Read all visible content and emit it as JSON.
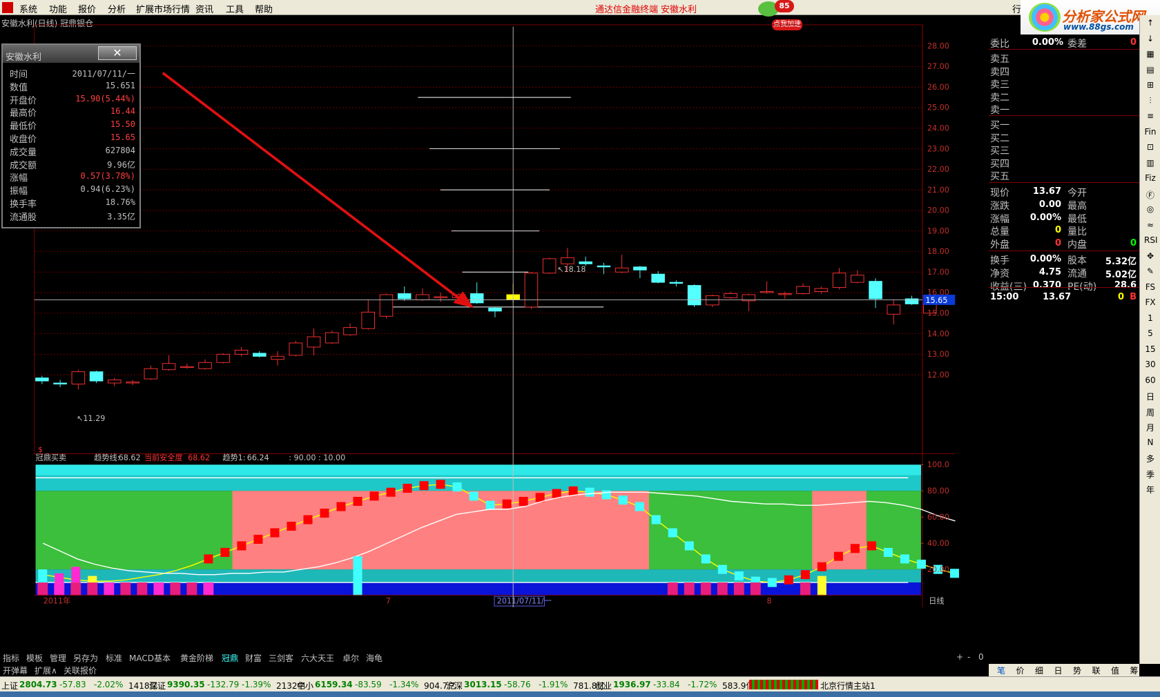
{
  "menu": {
    "items": [
      "系统",
      "功能",
      "报价",
      "分析",
      "扩展市场行情",
      "资讯",
      "工具",
      "帮助"
    ],
    "center_title_1": "通达信金融终端",
    "center_title_2": "安徽水利",
    "badge_num": "85",
    "badge_label": "点我加速",
    "logo_text": "分析家公式网",
    "logo_url": "www.88gs.com",
    "right_fragment": "行"
  },
  "chart": {
    "title": "安徽水利(日线) 冠鼎银仓",
    "price_axis": [
      "28.00",
      "27.00",
      "26.00",
      "25.00",
      "24.00",
      "23.00",
      "22.00",
      "21.00",
      "20.00",
      "19.00",
      "18.00",
      "17.00",
      "16.00",
      "15.00",
      "14.00",
      "13.00",
      "12.00"
    ],
    "crosshair_price": "15.65",
    "annot_high": "18.18",
    "annot_low": "11.29",
    "indicator_title": "冠鼎买卖",
    "ind_label_1": "趋势线:",
    "ind_val_1": "68.62",
    "ind_label_2": "当前安全度",
    "ind_val_2": "68.62",
    "ind_label_3": "趋势1:",
    "ind_val_3": "66.24",
    "ind_label_4": ": 90.00 : 10.00",
    "ind_axis": [
      "100.0",
      "80.00",
      "60.00",
      "40.00",
      "20.00"
    ],
    "date_left": "2011年",
    "date_m7": "7",
    "date_cursor": "2011/07/11/一",
    "date_m8": "8",
    "period": "日线"
  },
  "chart_data": {
    "type": "candlestick",
    "title": "安徽水利(日线) 冠鼎银仓",
    "ylim": [
      11.0,
      29.0
    ],
    "candles": [
      {
        "o": 11.85,
        "c": 11.7,
        "h": 11.95,
        "l": 11.55
      },
      {
        "o": 11.6,
        "c": 11.55,
        "h": 11.75,
        "l": 11.4
      },
      {
        "o": 11.55,
        "c": 12.15,
        "h": 12.25,
        "l": 11.29
      },
      {
        "o": 12.15,
        "c": 11.7,
        "h": 12.2,
        "l": 11.6
      },
      {
        "o": 11.6,
        "c": 11.75,
        "h": 11.85,
        "l": 11.45
      },
      {
        "o": 11.6,
        "c": 11.65,
        "h": 11.75,
        "l": 11.5
      },
      {
        "o": 11.8,
        "c": 12.3,
        "h": 12.45,
        "l": 11.75
      },
      {
        "o": 12.25,
        "c": 12.55,
        "h": 12.95,
        "l": 12.2
      },
      {
        "o": 12.4,
        "c": 12.4,
        "h": 12.55,
        "l": 12.3
      },
      {
        "o": 12.3,
        "c": 12.6,
        "h": 12.75,
        "l": 12.25
      },
      {
        "o": 12.6,
        "c": 13.0,
        "h": 13.05,
        "l": 12.55
      },
      {
        "o": 13.0,
        "c": 13.2,
        "h": 13.35,
        "l": 12.9
      },
      {
        "o": 13.05,
        "c": 12.9,
        "h": 13.15,
        "l": 12.85
      },
      {
        "o": 12.75,
        "c": 12.9,
        "h": 13.15,
        "l": 12.45
      },
      {
        "o": 12.95,
        "c": 13.55,
        "h": 13.65,
        "l": 12.9
      },
      {
        "o": 13.35,
        "c": 13.85,
        "h": 14.25,
        "l": 12.95
      },
      {
        "o": 13.55,
        "c": 14.05,
        "h": 14.15,
        "l": 13.5
      },
      {
        "o": 13.95,
        "c": 14.3,
        "h": 14.5,
        "l": 13.9
      },
      {
        "o": 14.25,
        "c": 15.05,
        "h": 15.65,
        "l": 14.2
      },
      {
        "o": 14.85,
        "c": 15.9,
        "h": 15.95,
        "l": 14.75
      },
      {
        "o": 15.95,
        "c": 15.7,
        "h": 16.3,
        "l": 15.6
      },
      {
        "o": 15.65,
        "c": 15.9,
        "h": 16.2,
        "l": 15.6
      },
      {
        "o": 15.8,
        "c": 15.8,
        "h": 16.0,
        "l": 15.55
      },
      {
        "o": 15.75,
        "c": 15.9,
        "h": 15.95,
        "l": 15.6
      },
      {
        "o": 15.95,
        "c": 15.5,
        "h": 16.5,
        "l": 15.45
      },
      {
        "o": 15.25,
        "c": 15.1,
        "h": 15.3,
        "l": 14.8
      },
      {
        "o": 15.9,
        "c": 15.65,
        "h": 16.44,
        "l": 15.5
      },
      {
        "o": 15.3,
        "c": 16.95,
        "h": 17.0,
        "l": 15.2
      },
      {
        "o": 16.95,
        "c": 17.65,
        "h": 17.7,
        "l": 16.9
      },
      {
        "o": 17.4,
        "c": 17.7,
        "h": 18.18,
        "l": 17.05
      },
      {
        "o": 17.5,
        "c": 17.4,
        "h": 17.75,
        "l": 17.3
      },
      {
        "o": 17.3,
        "c": 17.25,
        "h": 17.45,
        "l": 16.9
      },
      {
        "o": 17.0,
        "c": 17.2,
        "h": 17.85,
        "l": 16.95
      },
      {
        "o": 17.25,
        "c": 17.1,
        "h": 17.3,
        "l": 16.7
      },
      {
        "o": 16.9,
        "c": 16.5,
        "h": 17.05,
        "l": 16.45
      },
      {
        "o": 16.5,
        "c": 16.45,
        "h": 16.6,
        "l": 16.3
      },
      {
        "o": 16.35,
        "c": 15.4,
        "h": 16.4,
        "l": 15.3
      },
      {
        "o": 15.4,
        "c": 15.85,
        "h": 15.9,
        "l": 15.3
      },
      {
        "o": 15.75,
        "c": 15.95,
        "h": 16.05,
        "l": 15.7
      },
      {
        "o": 15.6,
        "c": 15.9,
        "h": 15.95,
        "l": 15.1
      },
      {
        "o": 16.0,
        "c": 16.05,
        "h": 16.55,
        "l": 15.95
      },
      {
        "o": 15.95,
        "c": 15.95,
        "h": 16.05,
        "l": 15.7
      },
      {
        "o": 15.95,
        "c": 16.3,
        "h": 16.45,
        "l": 15.9
      },
      {
        "o": 16.05,
        "c": 16.2,
        "h": 16.3,
        "l": 15.95
      },
      {
        "o": 16.25,
        "c": 16.95,
        "h": 17.2,
        "l": 16.15
      },
      {
        "o": 16.5,
        "c": 16.85,
        "h": 17.1,
        "l": 16.45
      },
      {
        "o": 16.55,
        "c": 15.7,
        "h": 16.7,
        "l": 15.25
      },
      {
        "o": 14.95,
        "c": 15.4,
        "h": 15.65,
        "l": 14.45
      },
      {
        "o": 15.7,
        "c": 15.45,
        "h": 15.85,
        "l": 15.4
      },
      {
        "o": 15.0,
        "c": 15.75,
        "h": 15.8,
        "l": 14.95
      }
    ],
    "resistance_lines": [
      25.5,
      23.0,
      21.0,
      19.0,
      17.0,
      15.3
    ],
    "indicator": {
      "ylim": [
        0,
        100
      ],
      "trend_line": [
        16,
        14,
        12,
        11,
        11,
        12,
        14,
        16,
        19,
        23,
        28,
        33,
        38,
        43,
        48,
        53,
        58,
        63,
        68,
        72,
        76,
        79,
        82,
        84,
        85,
        83,
        76,
        69,
        70,
        72,
        75,
        78,
        80,
        79,
        77,
        73,
        68,
        58,
        48,
        38,
        28,
        20,
        15,
        11,
        10,
        12,
        16,
        22,
        30,
        36,
        38,
        33,
        28,
        24,
        20,
        17
      ],
      "white_line": [
        40,
        34,
        28,
        24,
        21,
        19,
        18,
        17,
        17,
        16,
        16,
        17,
        17,
        18,
        18,
        20,
        22,
        25,
        29,
        34,
        40,
        46,
        52,
        57,
        62,
        64,
        66,
        66,
        68,
        72,
        75,
        77,
        78,
        79,
        79,
        79,
        78,
        77,
        76,
        74,
        72,
        71,
        70,
        70,
        69,
        69,
        70,
        71,
        72,
        71,
        69,
        66,
        61,
        57
      ],
      "pink_zones": [
        [
          11,
          33
        ],
        [
          43,
          45
        ]
      ]
    }
  },
  "infobox": {
    "title": "安徽水利",
    "close": "✕",
    "rows": [
      {
        "label": "时间",
        "value": "2011/07/11/一",
        "red": false
      },
      {
        "label": "数值",
        "value": "15.651",
        "red": false
      },
      {
        "label": "开盘价",
        "value": "15.90(5.44%)",
        "red": true
      },
      {
        "label": "最高价",
        "value": "16.44",
        "red": true
      },
      {
        "label": "最低价",
        "value": "15.50",
        "red": true
      },
      {
        "label": "收盘价",
        "value": "15.65",
        "red": true
      },
      {
        "label": "成交量",
        "value": "627804",
        "red": false
      },
      {
        "label": "成交额",
        "value": "9.96亿",
        "red": false
      },
      {
        "label": "涨幅",
        "value": "0.57(3.78%)",
        "red": true
      },
      {
        "label": "振幅",
        "value": "0.94(6.23%)",
        "red": false
      },
      {
        "label": "换手率",
        "value": "18.76%",
        "red": false
      },
      {
        "label": "流通股",
        "value": "3.35亿",
        "red": false
      }
    ]
  },
  "quote": {
    "weibi_label": "委比",
    "weibi_val": "0.00%",
    "weicha_label": "委差",
    "weicha_val": "0",
    "sells": [
      "卖五",
      "卖四",
      "卖三",
      "卖二",
      "卖一"
    ],
    "buys": [
      "买一",
      "买二",
      "买三",
      "买四",
      "买五"
    ],
    "r1": {
      "l1": "现价",
      "v1": "13.67",
      "l2": "今开",
      "v2": ""
    },
    "r2": {
      "l1": "涨跌",
      "v1": "0.00",
      "l2": "最高",
      "v2": ""
    },
    "r3": {
      "l1": "涨幅",
      "v1": "0.00%",
      "l2": "最低",
      "v2": ""
    },
    "r4": {
      "l1": "总量",
      "v1": "0",
      "l2": "量比",
      "v2": ""
    },
    "r5": {
      "l1": "外盘",
      "v1": "0",
      "l2": "内盘",
      "v2": "0"
    },
    "r6": {
      "l1": "换手",
      "v1": "0.00%",
      "l2": "股本",
      "v2": "5.32亿"
    },
    "r7": {
      "l1": "净资",
      "v1": "4.75",
      "l2": "流通",
      "v2": "5.02亿"
    },
    "r8": {
      "l1": "收益(三)",
      "v1": "0.370",
      "l2": "PE(动)",
      "v2": "28.6"
    },
    "tick": {
      "time": "15:00",
      "price": "13.67",
      "vol": "0",
      "side": "B"
    }
  },
  "side_toolbar": [
    "↑",
    "↓",
    "▦",
    "▤",
    "⊞",
    "⫶",
    "≡",
    "Fin",
    "⊡",
    "▥",
    "Fiz",
    "Ⓕ",
    "◎",
    "≈",
    "RSI",
    "✥",
    "✎",
    "FS",
    "FX",
    "1",
    "5",
    "15",
    "30",
    "60",
    "日",
    "周",
    "月",
    "N",
    "多",
    "季",
    "年"
  ],
  "tabs": [
    "指标",
    "模板",
    "管理",
    "另存为",
    "标准",
    "MACD基本",
    "黄金阶梯",
    "冠鼎",
    "财富",
    "三剑客",
    "六大天王",
    "卓尔",
    "海龟"
  ],
  "tabs_right": [
    "+",
    "-",
    "0"
  ],
  "tabs2": [
    "开弹幕",
    "扩展∧",
    "关联报价"
  ],
  "bottom_tools": [
    "笔",
    "价",
    "细",
    "日",
    "势",
    "联",
    "值",
    "筹"
  ],
  "status": [
    {
      "name": "上证",
      "val": "2804.73",
      "chg": "-57.83",
      "pct": "-2.02%",
      "amt": "1418亿"
    },
    {
      "name": "深证",
      "val": "9390.35",
      "chg": "-132.79",
      "pct": "-1.39%",
      "amt": "2132亿"
    },
    {
      "name": "中小",
      "val": "6159.34",
      "chg": "-83.59",
      "pct": "-1.34%",
      "amt": "904.7亿"
    },
    {
      "name": "沪深",
      "val": "3013.15",
      "chg": "-58.76",
      "pct": "-1.91%",
      "amt": "781.8亿"
    },
    {
      "name": "创业",
      "val": "1936.97",
      "chg": "-33.84",
      "pct": "-1.72%",
      "amt": "583.9亿"
    }
  ],
  "status_server": "北京行情主站1",
  "colors": {
    "up": "#ff3333",
    "down": "#54ffff",
    "cursor": "#ffff00",
    "grid": "#800000"
  }
}
